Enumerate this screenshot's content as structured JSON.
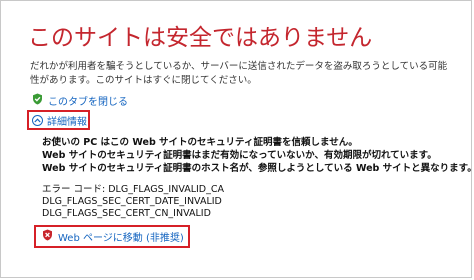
{
  "page": {
    "title": "このサイトは安全ではありません",
    "description": "だれかが利用者を騙そうとしているか、サーバーに送信されたデータを盗み取ろうとしている可能性があります。このサイトはすぐに閉じてください。"
  },
  "links": {
    "close_tab": "このタブを閉じる",
    "details": "詳細情報",
    "go_to_page": "Web ページに移動 (非推奨)"
  },
  "details": {
    "lines": [
      "お使いの PC はこの Web サイトのセキュリティ証明書を信頼しません。",
      "Web サイトのセキュリティ証明書はまだ有効になっていないか、有効期限が切れています。",
      "Web サイトのセキュリティ証明書のホスト名が、参照しようとしている Web サイトと異なります。"
    ],
    "error_code_label": "エラー コード: DLG_FLAGS_INVALID_CA",
    "codes": [
      "DLG_FLAGS_SEC_CERT_DATE_INVALID",
      "DLG_FLAGS_SEC_CERT_CN_INVALID"
    ]
  },
  "icons": {
    "close_tab": "green-shield-check-icon",
    "details": "circle-chevron-up-icon",
    "go_to_page": "red-shield-x-icon"
  },
  "colors": {
    "title": "#c4262e",
    "link": "#1565c0",
    "highlight_box": "#d62027",
    "shield_green": "#3a9b35",
    "shield_red": "#c8262c"
  }
}
